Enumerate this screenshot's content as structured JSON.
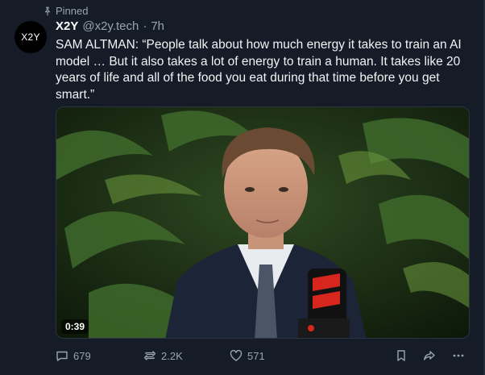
{
  "pinned": {
    "label": "Pinned",
    "icon": "pin-icon"
  },
  "author": {
    "avatar_text": "X2Y",
    "display_name": "X2Y",
    "handle": "@x2y.tech",
    "separator": "·",
    "time": "7h"
  },
  "post": {
    "text": "SAM ALTMAN: “People talk about how much energy it takes to train an AI model … But it also takes a lot of energy to train a human. It takes like 20 years of life and all of the food you eat during that time before you get smart.”"
  },
  "media": {
    "type": "video",
    "duration": "0:39"
  },
  "actions": {
    "replies": "679",
    "reposts": "2.2K",
    "likes": "571"
  },
  "colors": {
    "background": "#151c27",
    "text": "#f1f3f5",
    "muted": "#9aa4b0"
  }
}
